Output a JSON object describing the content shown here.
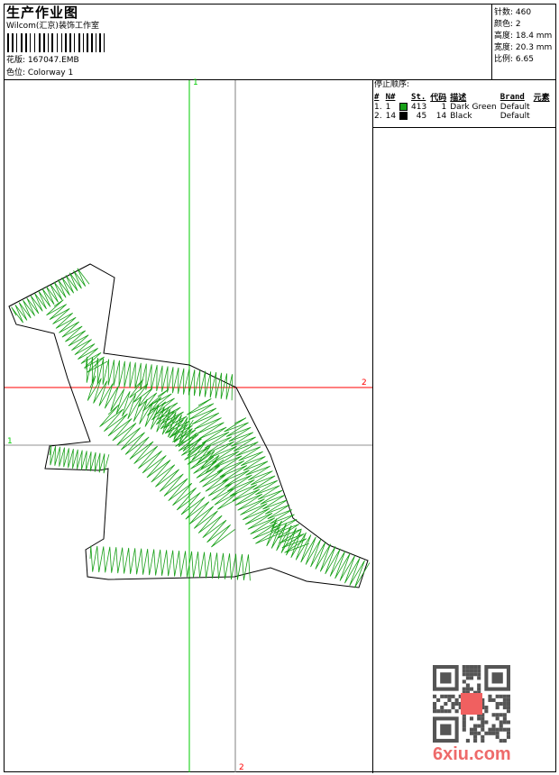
{
  "header": {
    "title": "生产作业图",
    "company": "Wilcom(汇京)装饰工作室",
    "design_label": "花版: 167047.EMB",
    "colorway_label": "色位: Colorway 1"
  },
  "stats": {
    "stitches": "针数: 460",
    "colors": "颜色: 2",
    "height": "高度: 18.4 mm",
    "width": "宽度: 20.3 mm",
    "scale": "比例: 6.65"
  },
  "stop_sequence": {
    "title": "停止顺序:",
    "columns": [
      "#",
      "N#",
      "",
      "St.",
      "代码",
      "描述",
      "Brand",
      "元素"
    ],
    "rows": [
      {
        "idx": "1.",
        "n": "1",
        "color": "#18a018",
        "st": "413",
        "code": "1",
        "desc": "Dark Green",
        "brand": "Default",
        "elem": ""
      },
      {
        "idx": "2.",
        "n": "14",
        "color": "#000000",
        "st": "45",
        "code": "14",
        "desc": "Black",
        "brand": "Default",
        "elem": ""
      }
    ]
  },
  "markers": {
    "v1": "1",
    "v2": "2",
    "h1": "1",
    "h2": "2"
  },
  "colors": {
    "green_axis": "#00cc00",
    "red_axis": "#ff0000",
    "gray_axis": "#808080",
    "stitch": "#18a018"
  },
  "watermark": {
    "text": "6xiu.com",
    "seal": "以图搜版"
  }
}
